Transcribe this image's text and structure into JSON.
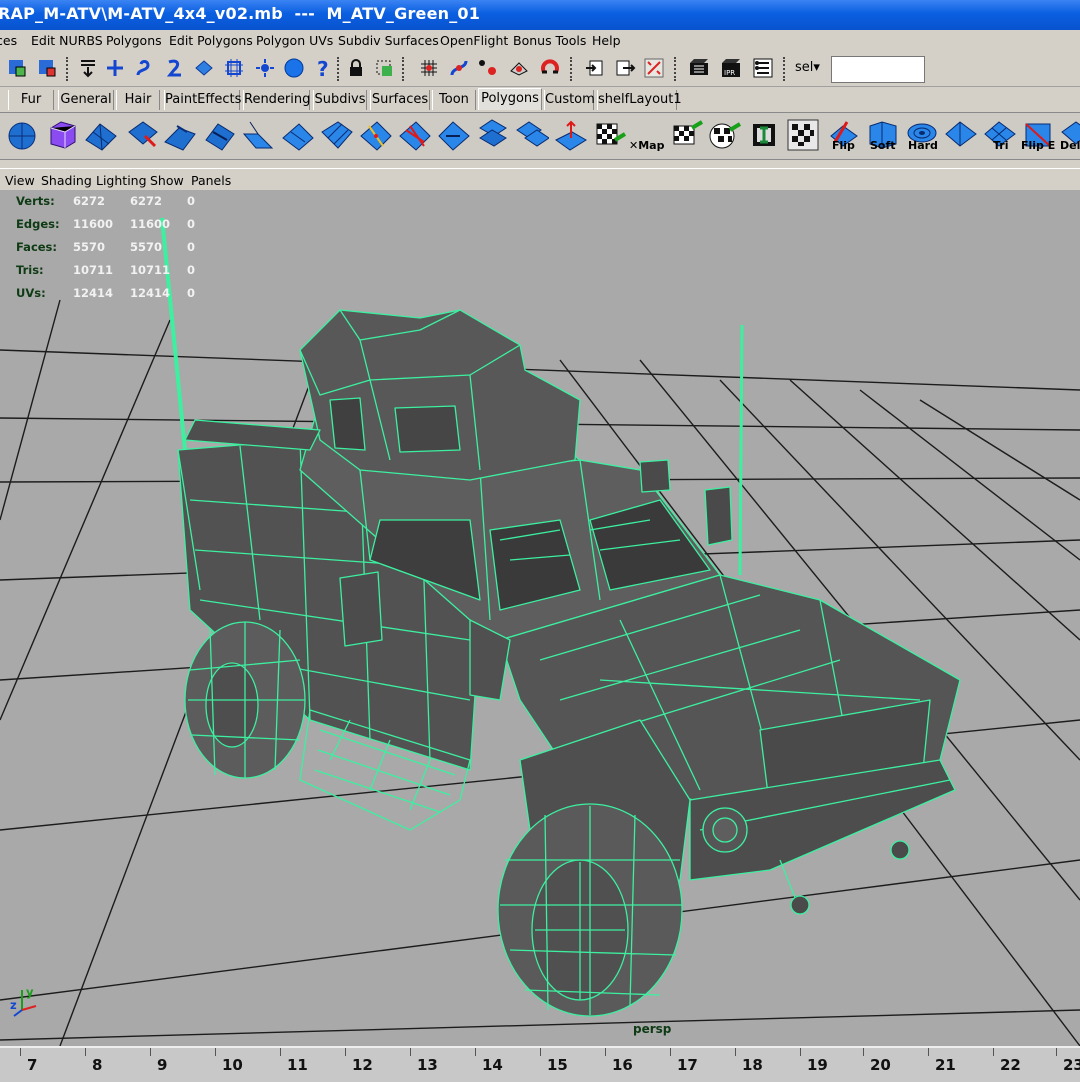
{
  "window": {
    "title": "RAP_M-ATV\\M-ATV_4x4_v02.mb  ---  M_ATV_Green_01"
  },
  "menubar": [
    "ces",
    "Edit NURBS",
    "Polygons",
    "Edit Polygons",
    "Polygon UVs",
    "Subdiv Surfaces",
    "OpenFlight",
    "Bonus Tools",
    "Help"
  ],
  "toolbar": {
    "sel_label": "sel▾",
    "sel_value": ""
  },
  "shelf_tabs": [
    "Fur",
    "General",
    "Hair",
    "PaintEffects",
    "Rendering",
    "Subdivs",
    "Surfaces",
    "Toon",
    "Polygons",
    "Custom",
    "shelfLayout1"
  ],
  "active_shelf_tab": "Polygons",
  "shelf_labels": {
    "map": "✕Map",
    "flip": "Flip",
    "soft": "Soft",
    "hard": "Hard",
    "tri": "Tri",
    "flipe": "Flip E",
    "del": "Del"
  },
  "panel_menu": [
    "View",
    "Shading",
    "Lighting",
    "Show",
    "Panels"
  ],
  "hud": [
    {
      "label": "Verts:",
      "a": "6272",
      "b": "6272",
      "c": "0"
    },
    {
      "label": "Edges:",
      "a": "11600",
      "b": "11600",
      "c": "0"
    },
    {
      "label": "Faces:",
      "a": "5570",
      "b": "5570",
      "c": "0"
    },
    {
      "label": "Tris:",
      "a": "10711",
      "b": "10711",
      "c": "0"
    },
    {
      "label": "UVs:",
      "a": "12414",
      "b": "12414",
      "c": "0"
    }
  ],
  "camera_label": "persp",
  "axis": {
    "z": "z",
    "y": "y"
  },
  "timeline_ticks": [
    "7",
    "8",
    "9",
    "10",
    "11",
    "12",
    "13",
    "14",
    "15",
    "16",
    "17",
    "18",
    "19",
    "20",
    "21",
    "22",
    "23"
  ],
  "colors": {
    "wire": "#3cf0a0",
    "viewport_bg": "#a9a9a9",
    "model": "#5a5a5a",
    "title_blue": "#0a5fe0"
  }
}
